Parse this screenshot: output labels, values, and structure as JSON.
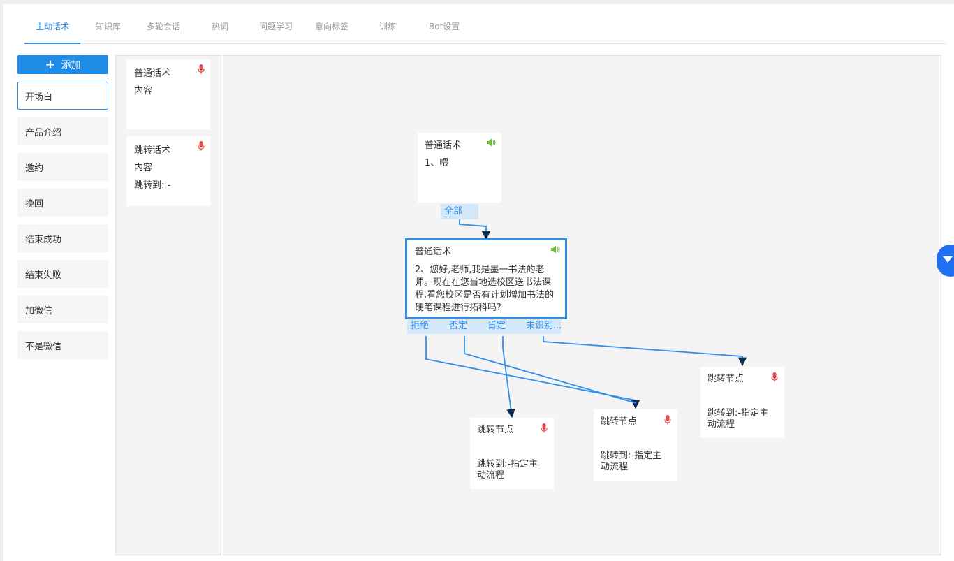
{
  "tabs": [
    {
      "label": "主动话术",
      "active": true
    },
    {
      "label": "知识库"
    },
    {
      "label": "多轮会话"
    },
    {
      "label": "热词"
    },
    {
      "label": "问题学习"
    },
    {
      "label": "意向标签"
    },
    {
      "label": "训练"
    },
    {
      "label": "Bot设置"
    }
  ],
  "sidebar": {
    "add_label": "添加",
    "categories": [
      "开场白",
      "产品介绍",
      "邀约",
      "挽回",
      "结束成功",
      "结束失败",
      "加微信",
      "不是微信"
    ]
  },
  "palette": {
    "cards": [
      {
        "title": "普通话术",
        "line1": "内容"
      },
      {
        "title": "跳转话术",
        "line1": "内容",
        "line2": "跳转到: -"
      }
    ]
  },
  "flow": {
    "node1": {
      "title": "普通话术",
      "text": "1、喂",
      "port": "全部"
    },
    "node2": {
      "title": "普通话术",
      "text": "2、您好,老师,我是墨一书法的老师。现在在您当地选校区送书法课程,看您校区是否有计划增加书法的硬笔课程进行拓科吗?",
      "ports": [
        "拒绝",
        "否定",
        "肯定",
        "未识别..."
      ]
    },
    "jumps": [
      {
        "title": "跳转节点",
        "target": "跳转到:-指定主动流程"
      },
      {
        "title": "跳转节点",
        "target": "跳转到:-指定主动流程"
      },
      {
        "title": "跳转节点",
        "target": "跳转到:-指定主动流程"
      }
    ]
  },
  "colors": {
    "accent": "#2f8ee8",
    "mic": "#e8464a",
    "speaker": "#6abe2f"
  }
}
